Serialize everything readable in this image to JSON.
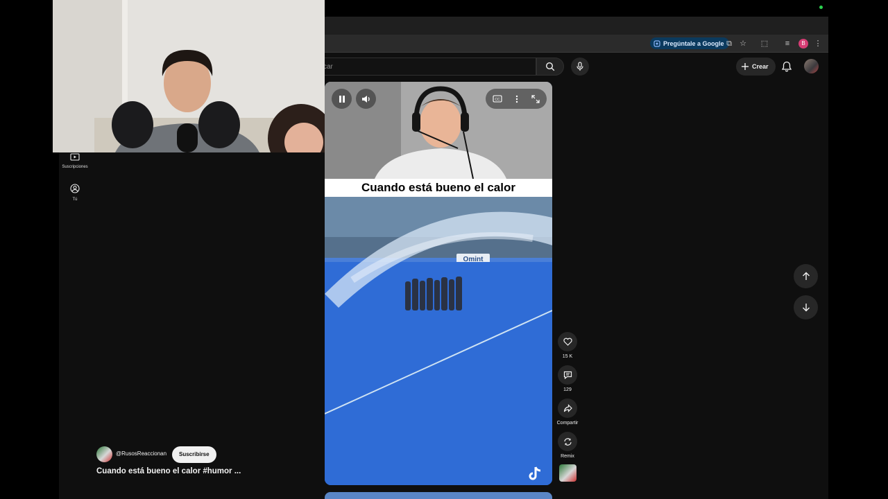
{
  "browser": {
    "ask_google_label": "Pregúntale a Google",
    "profile_initial": "B"
  },
  "header": {
    "search_placeholder": "car",
    "create_label": "Crear"
  },
  "sidebar": {
    "items": [
      {
        "label": "Suscripciones",
        "icon": "subscriptions-icon"
      },
      {
        "label": "Tú",
        "icon": "you-icon"
      }
    ]
  },
  "video": {
    "caption": "Cuando está bueno el calor",
    "sign_text": "Omint"
  },
  "actions": {
    "like_count": "15 K",
    "comment_count": "129",
    "share_label": "Compartir",
    "remix_label": "Remix"
  },
  "channel": {
    "handle": "@RusosReaccionan",
    "subscribe_label": "Suscribirse",
    "short_title": "Cuando está bueno el calor #humor ..."
  },
  "colors": {
    "page_bg": "#0f0f0f",
    "ask_google_bg": "#0b3a5e",
    "field_blue": "#2f6fd9",
    "profile_pink": "#d63c74"
  }
}
